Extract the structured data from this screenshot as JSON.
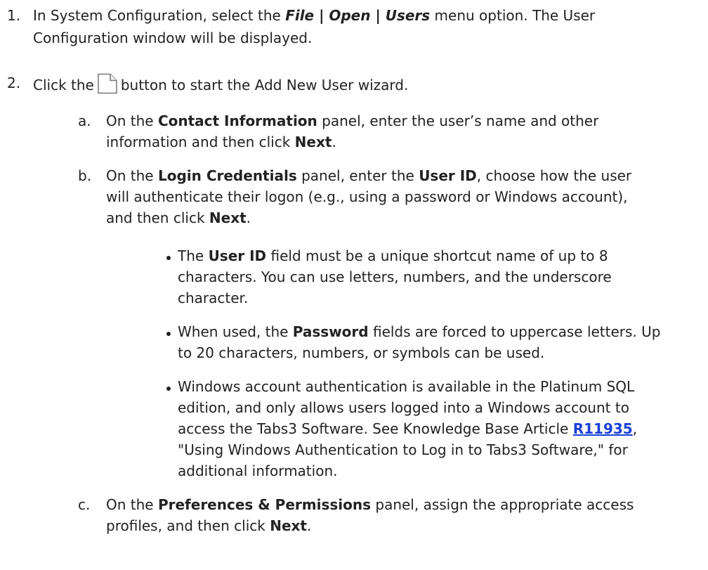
{
  "step1": {
    "num": "1.",
    "t1": "In System Configuration, select the ",
    "menu": "File | Open | Users",
    "t2": " menu option. The User",
    "t3": "Configuration window will be displayed."
  },
  "step2": {
    "num": "2.",
    "t1": "Click the",
    "icon": "new-document-icon",
    "t2": "button to start the Add New User wizard."
  },
  "a": {
    "letter": "a.",
    "t1": "On the ",
    "b1": "Contact Information",
    "t2": " panel, enter the user’s name and other",
    "t3": "information and then click ",
    "b2": "Next",
    "t4": "."
  },
  "b": {
    "letter": "b.",
    "t1": "On the ",
    "b1": "Login Credentials",
    "t2": " panel, enter the ",
    "b2": "User ID",
    "t3": ", choose how the user",
    "t4": "will authenticate their logon (e.g., using a password or Windows account),",
    "t5": "and then click ",
    "b3": "Next",
    "t6": "."
  },
  "bullet1": {
    "t1": "The ",
    "b1": "User ID",
    "t2": " field must be a unique shortcut name of up to 8",
    "t3": "characters. You can use letters, numbers, and the underscore",
    "t4": "character."
  },
  "bullet2": {
    "t1": "When used, the ",
    "b1": "Password",
    "t2": " fields are forced to uppercase letters. Up",
    "t3": "to 20 characters, numbers, or symbols can be used."
  },
  "bullet3": {
    "t1": "Windows account authentication is available in the Platinum SQL",
    "t2": "edition, and only allows users logged into a Windows account to",
    "t3": "access the Tabs3 Software. See Knowledge Base Article ",
    "link": "R11935",
    "t4": ",",
    "t5": "\"Using Windows Authentication to Log in to Tabs3 Software,\" for",
    "t6": "additional information."
  },
  "c": {
    "letter": "c.",
    "t1": "On the ",
    "b1": "Preferences & Permissions",
    "t2": " panel, assign the appropriate access",
    "t3": "profiles, and then click ",
    "b2": "Next",
    "t4": "."
  }
}
